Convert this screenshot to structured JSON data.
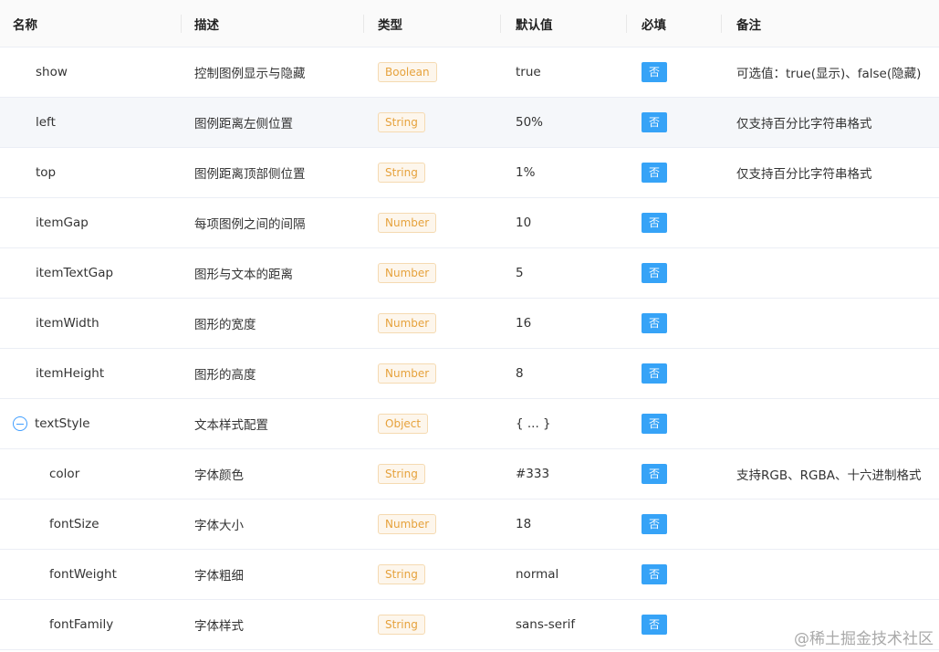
{
  "table": {
    "headers": {
      "name": "名称",
      "desc": "描述",
      "type": "类型",
      "default": "默认值",
      "required": "必填",
      "note": "备注"
    },
    "rows": [
      {
        "name": "show",
        "desc": "控制图例显示与隐藏",
        "type": "Boolean",
        "default": "true",
        "required": "否",
        "note": "可选值：true(显示)、false(隐藏)"
      },
      {
        "name": "left",
        "desc": "图例距离左侧位置",
        "type": "String",
        "default": "50%",
        "required": "否",
        "note": "仅支持百分比字符串格式"
      },
      {
        "name": "top",
        "desc": "图例距离顶部侧位置",
        "type": "String",
        "default": "1%",
        "required": "否",
        "note": "仅支持百分比字符串格式"
      },
      {
        "name": "itemGap",
        "desc": "每项图例之间的间隔",
        "type": "Number",
        "default": "10",
        "required": "否",
        "note": ""
      },
      {
        "name": "itemTextGap",
        "desc": "图形与文本的距离",
        "type": "Number",
        "default": "5",
        "required": "否",
        "note": ""
      },
      {
        "name": "itemWidth",
        "desc": "图形的宽度",
        "type": "Number",
        "default": "16",
        "required": "否",
        "note": ""
      },
      {
        "name": "itemHeight",
        "desc": "图形的高度",
        "type": "Number",
        "default": "8",
        "required": "否",
        "note": ""
      },
      {
        "name": "textStyle",
        "desc": "文本样式配置",
        "type": "Object",
        "default": "{ ... }",
        "required": "否",
        "note": "",
        "expanded": true,
        "expand_icon": "collapse-minus-icon"
      },
      {
        "name": "color",
        "desc": "字体颜色",
        "type": "String",
        "default": "#333",
        "required": "否",
        "note": "支持RGB、RGBA、十六进制格式"
      },
      {
        "name": "fontSize",
        "desc": "字体大小",
        "type": "Number",
        "default": "18",
        "required": "否",
        "note": ""
      },
      {
        "name": "fontWeight",
        "desc": "字体粗细",
        "type": "String",
        "default": "normal",
        "required": "否",
        "note": ""
      },
      {
        "name": "fontFamily",
        "desc": "字体样式",
        "type": "String",
        "default": "sans-serif",
        "required": "否",
        "note": ""
      }
    ]
  },
  "watermark": "@稀土掘金技术社区",
  "colors": {
    "tag_text": "#e6a23c",
    "tag_bg": "#fdf6ec",
    "tag_border": "#f5dab1",
    "badge_bg": "#36a3f7",
    "hover_row_bg": "#f5f7fa"
  }
}
